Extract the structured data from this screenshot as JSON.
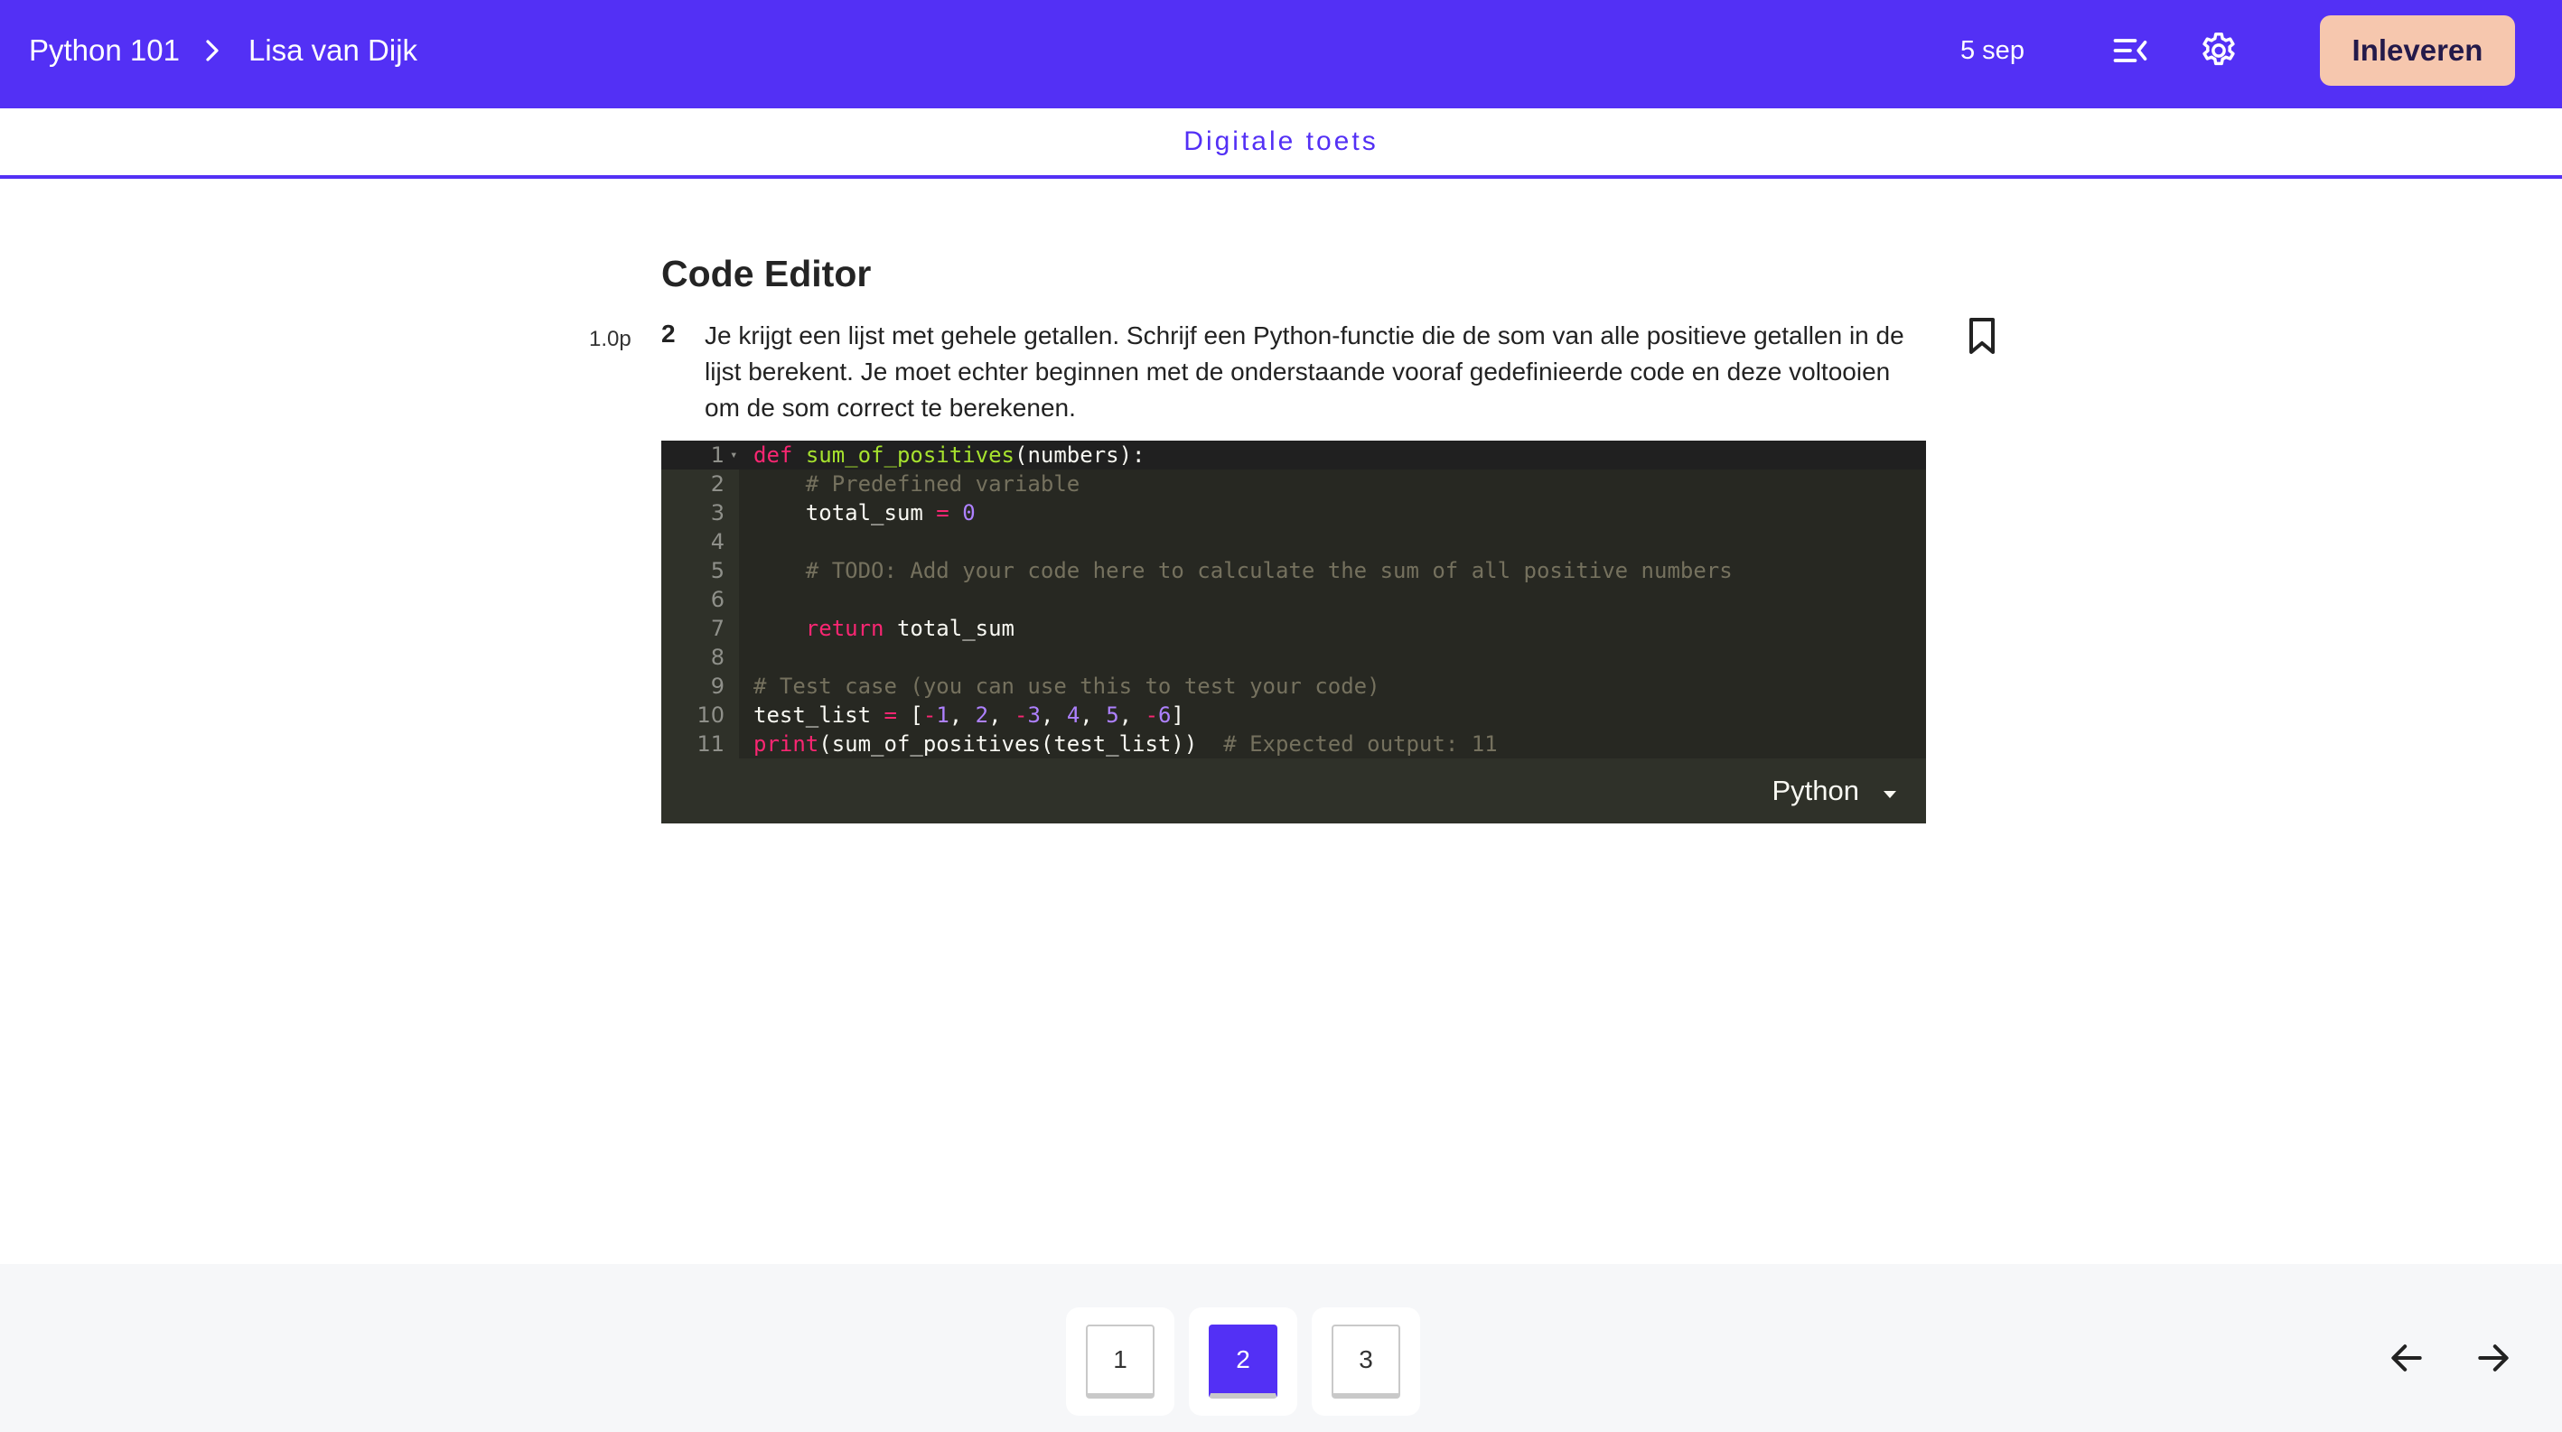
{
  "header": {
    "course": "Python 101",
    "student": "Lisa van Dijk",
    "date": "5 sep",
    "submit_label": "Inleveren",
    "brand_color": "#5330f5",
    "submit_color": "#f6c7ae"
  },
  "subheader": {
    "title": "Digitale toets"
  },
  "question": {
    "section_title": "Code Editor",
    "points": "1.0p",
    "number": "2",
    "text": "Je krijgt een lijst met gehele getallen. Schrijf een Python-functie die de som van alle positieve getallen in de lijst berekent. Je moet echter beginnen met de onderstaande vooraf gedefinieerde code en deze voltooien om de som correct te berekenen."
  },
  "editor": {
    "language": "Python",
    "line_numbers": [
      "1",
      "2",
      "3",
      "4",
      "5",
      "6",
      "7",
      "8",
      "9",
      "10",
      "11"
    ],
    "lines": [
      "def sum_of_positives(numbers):",
      "    # Predefined variable",
      "    total_sum = 0",
      "",
      "    # TODO: Add your code here to calculate the sum of all positive numbers",
      "",
      "    return total_sum",
      "",
      "# Test case (you can use this to test your code)",
      "test_list = [-1, 2, -3, 4, 5, -6]",
      "print(sum_of_positives(test_list))  # Expected output: 11"
    ]
  },
  "pagination": {
    "pages": [
      "1",
      "2",
      "3"
    ],
    "current": "2"
  },
  "icons": {
    "breadcrumb_separator": "chevron-right-icon",
    "menu": "menu-collapse-icon",
    "settings": "gear-icon",
    "bookmark": "bookmark-icon",
    "dropdown": "caret-down-icon",
    "prev": "arrow-left-icon",
    "next": "arrow-right-icon"
  }
}
